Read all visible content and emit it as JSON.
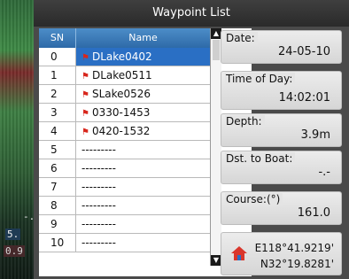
{
  "map": {
    "readout_top": "-.",
    "readout_mid": "5.",
    "readout_bottom": "0.9"
  },
  "dialog": {
    "title": "Waypoint List"
  },
  "table": {
    "headers": [
      "SN",
      "Name"
    ],
    "rows": [
      {
        "sn": "0",
        "name": "DLake0402",
        "flag": true,
        "selected": true
      },
      {
        "sn": "1",
        "name": "DLake0511",
        "flag": true,
        "selected": false
      },
      {
        "sn": "2",
        "name": "SLake0526",
        "flag": true,
        "selected": false
      },
      {
        "sn": "3",
        "name": "0330-1453",
        "flag": true,
        "selected": false
      },
      {
        "sn": "4",
        "name": "0420-1532",
        "flag": true,
        "selected": false
      },
      {
        "sn": "5",
        "name": "---------",
        "flag": false,
        "selected": false
      },
      {
        "sn": "6",
        "name": "---------",
        "flag": false,
        "selected": false
      },
      {
        "sn": "7",
        "name": "---------",
        "flag": false,
        "selected": false
      },
      {
        "sn": "8",
        "name": "---------",
        "flag": false,
        "selected": false
      },
      {
        "sn": "9",
        "name": "---------",
        "flag": false,
        "selected": false
      },
      {
        "sn": "10",
        "name": "---------",
        "flag": false,
        "selected": false
      }
    ]
  },
  "info": {
    "date_label": "Date:",
    "date_value": "24-05-10",
    "time_label": "Time of Day:",
    "time_value": "14:02:01",
    "depth_label": "Depth:",
    "depth_value": "3.9m",
    "dst_label": "Dst. to Boat:",
    "dst_value": "-.-",
    "course_label": "Course:(°)",
    "course_value": "161.0",
    "home_lon": "E118°41.9219'",
    "home_lat": "N32°19.8281'"
  },
  "icons": {
    "flag": "flag-icon",
    "home": "home-icon",
    "scroll_up": "scroll-up-icon",
    "scroll_down": "scroll-down-icon"
  },
  "colors": {
    "header": "#3b7dbb",
    "selected": "#2a6fc4",
    "flag": "#d8261c"
  }
}
